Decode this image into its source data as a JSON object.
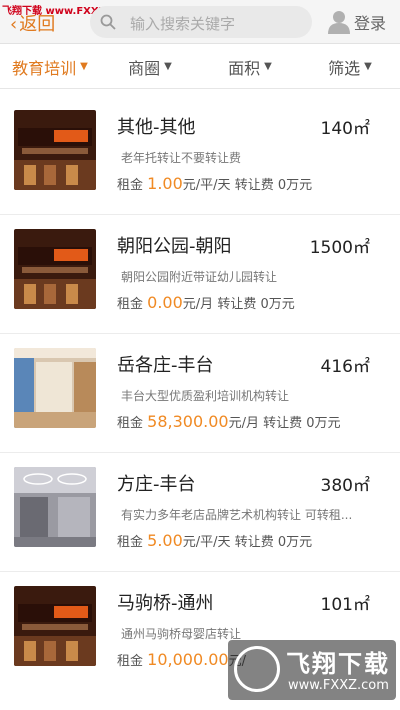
{
  "watermark_top": "飞翔下载 www.FXXZ.com",
  "header": {
    "back_label": "返回",
    "search_placeholder": "输入搜索关键字",
    "login_label": "登录"
  },
  "filters": [
    {
      "label": "教育培训",
      "active": true
    },
    {
      "label": "商圈",
      "active": false
    },
    {
      "label": "面积",
      "active": false
    },
    {
      "label": "筛选",
      "active": false
    }
  ],
  "listings": [
    {
      "title": "其他-其他",
      "area": "140㎡",
      "desc": "老年托转让不要转让费",
      "rent_label": "租金",
      "rent_value": "1.00",
      "rent_unit": "元/平/天",
      "transfer": "转让费 0万元",
      "thumb": "shop-sign"
    },
    {
      "title": "朝阳公园-朝阳",
      "area": "1500㎡",
      "desc": "朝阳公园附近带证幼儿园转让",
      "rent_label": "租金",
      "rent_value": "0.00",
      "rent_unit": "元/月",
      "transfer": "转让费 0万元",
      "thumb": "shop-sign"
    },
    {
      "title": "岳各庄-丰台",
      "area": "416㎡",
      "desc": "丰台大型优质盈利培训机构转让",
      "rent_label": "租金",
      "rent_value": "58,300.00",
      "rent_unit": "元/月",
      "transfer": "转让费 0万元",
      "thumb": "interior"
    },
    {
      "title": "方庄-丰台",
      "area": "380㎡",
      "desc": "有实力多年老店品牌艺术机构转让 可转租...",
      "rent_label": "租金",
      "rent_value": "5.00",
      "rent_unit": "元/平/天",
      "transfer": "转让费 0万元",
      "thumb": "office"
    },
    {
      "title": "马驹桥-通州",
      "area": "101㎡",
      "desc": "通州马驹桥母婴店转让",
      "rent_label": "租金",
      "rent_value": "10,000.00",
      "rent_unit": "元/",
      "transfer": "",
      "thumb": "shop-sign"
    }
  ],
  "watermark_logo": {
    "brand": "飞翔下载",
    "url": "www.FXXZ.com"
  },
  "colors": {
    "accent": "#e07a1f",
    "price": "#f08a24"
  }
}
